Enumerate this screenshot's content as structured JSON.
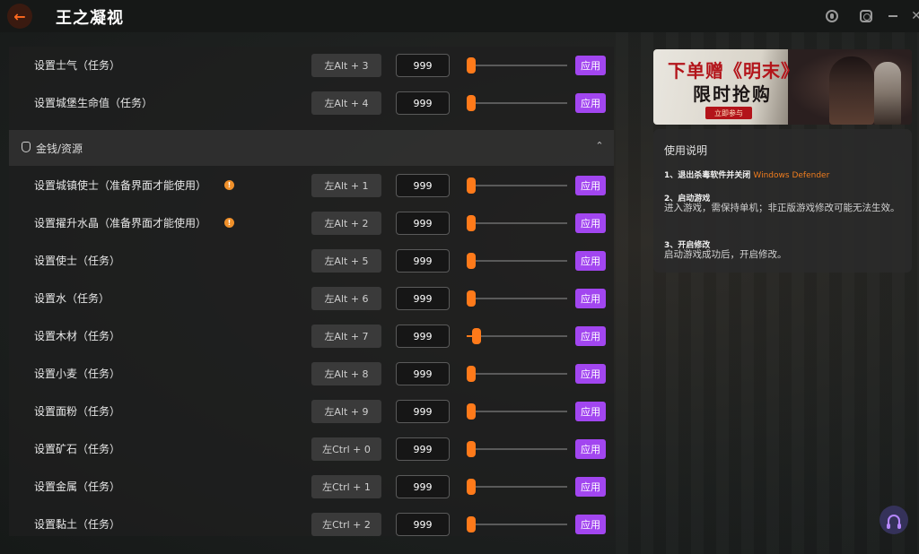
{
  "app": {
    "title": "王之凝视",
    "back_glyph": "←"
  },
  "titlebar_icons": [
    "user-icon",
    "settings-icon",
    "minimize-icon",
    "close-icon"
  ],
  "colors": {
    "accent": "#ff7a1a",
    "apply": "#a246f0",
    "highlight": "#f07d1e"
  },
  "top_rows": [
    {
      "label": "设置士气（任务）",
      "hotkey": "左Alt + 3",
      "value": "999",
      "slider": 0,
      "apply": "应用"
    },
    {
      "label": "设置城堡生命值（任务）",
      "hotkey": "左Alt + 4",
      "value": "999",
      "slider": 0,
      "apply": "应用"
    }
  ],
  "section": {
    "title": "金钱/资源",
    "collapse_glyph": "⌃"
  },
  "rows": [
    {
      "label": "设置城镇使士（准备界面才能使用）",
      "info": true,
      "hotkey": "左Alt + 1",
      "value": "999",
      "slider": 0,
      "apply": "应用"
    },
    {
      "label": "设置擢升水晶（准备界面才能使用）",
      "info": true,
      "hotkey": "左Alt + 2",
      "value": "999",
      "slider": 0,
      "apply": "应用"
    },
    {
      "label": "设置使士（任务）",
      "hotkey": "左Alt + 5",
      "value": "999",
      "slider": 0,
      "apply": "应用"
    },
    {
      "label": "设置水（任务）",
      "hotkey": "左Alt + 6",
      "value": "999",
      "slider": 0,
      "apply": "应用"
    },
    {
      "label": "设置木材（任务）",
      "hotkey": "左Alt + 7",
      "value": "999",
      "slider": 0.1,
      "apply": "应用"
    },
    {
      "label": "设置小麦（任务）",
      "hotkey": "左Alt + 8",
      "value": "999",
      "slider": 0,
      "apply": "应用"
    },
    {
      "label": "设置面粉（任务）",
      "hotkey": "左Alt + 9",
      "value": "999",
      "slider": 0,
      "apply": "应用"
    },
    {
      "label": "设置矿石（任务）",
      "hotkey": "左Ctrl + 0",
      "value": "999",
      "slider": 0,
      "apply": "应用"
    },
    {
      "label": "设置金属（任务）",
      "hotkey": "左Ctrl + 1",
      "value": "999",
      "slider": 0,
      "apply": "应用"
    },
    {
      "label": "设置黏土（任务）",
      "hotkey": "左Ctrl + 2",
      "value": "999",
      "slider": 0,
      "apply": "应用"
    }
  ],
  "info_glyph": "!",
  "banner": {
    "line1": "下单赠《明末》",
    "line2": "限时抢购",
    "cta": "立即参与"
  },
  "instructions": {
    "title": "使用说明",
    "step1_title": "1、退出杀毒软件并关闭",
    "step1_highlight": "Windows Defender",
    "step2_title": "2、启动游戏",
    "step2_body": "进入游戏，需保持单机；非正版游戏修改可能无法生效。",
    "step3_title": "3、开启修改",
    "step3_body": "启动游戏成功后，开启修改。"
  }
}
